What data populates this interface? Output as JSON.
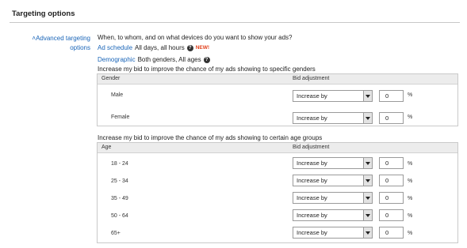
{
  "section": {
    "title": "Targeting options"
  },
  "advanced": {
    "label_line1": "Advanced targeting",
    "label_line2": "options"
  },
  "question": "When, to whom, and on what devices do you want to show your ads?",
  "ad_schedule": {
    "link": "Ad schedule",
    "value": "All days, all hours",
    "badge": "NEW!"
  },
  "demographic": {
    "link": "Demographic",
    "value": "Both genders, All ages"
  },
  "gender": {
    "caption": "Increase my bid to improve the chance of my ads showing to specific genders",
    "col_name": "Gender",
    "col_bid": "Bid adjustment",
    "rows": [
      {
        "label": "Male",
        "mode": "Increase by",
        "value": "0",
        "unit": "%"
      },
      {
        "label": "Female",
        "mode": "Increase by",
        "value": "0",
        "unit": "%"
      }
    ]
  },
  "age": {
    "caption": "Increase my bid to improve the chance of my ads showing to certain age groups",
    "col_name": "Age",
    "col_bid": "Bid adjustment",
    "rows": [
      {
        "label": "18 - 24",
        "mode": "Increase by",
        "value": "0",
        "unit": "%"
      },
      {
        "label": "25 - 34",
        "mode": "Increase by",
        "value": "0",
        "unit": "%"
      },
      {
        "label": "35 - 49",
        "mode": "Increase by",
        "value": "0",
        "unit": "%"
      },
      {
        "label": "50 - 64",
        "mode": "Increase by",
        "value": "0",
        "unit": "%"
      },
      {
        "label": "65+",
        "mode": "Increase by",
        "value": "0",
        "unit": "%"
      }
    ]
  },
  "icons": {
    "help": "help-icon",
    "collapse": "chevron-up-icon",
    "dropdown": "dropdown-arrow-icon"
  },
  "colors": {
    "link": "#1a65b8",
    "badge": "#e2401c",
    "header_bg": "#ececec"
  }
}
